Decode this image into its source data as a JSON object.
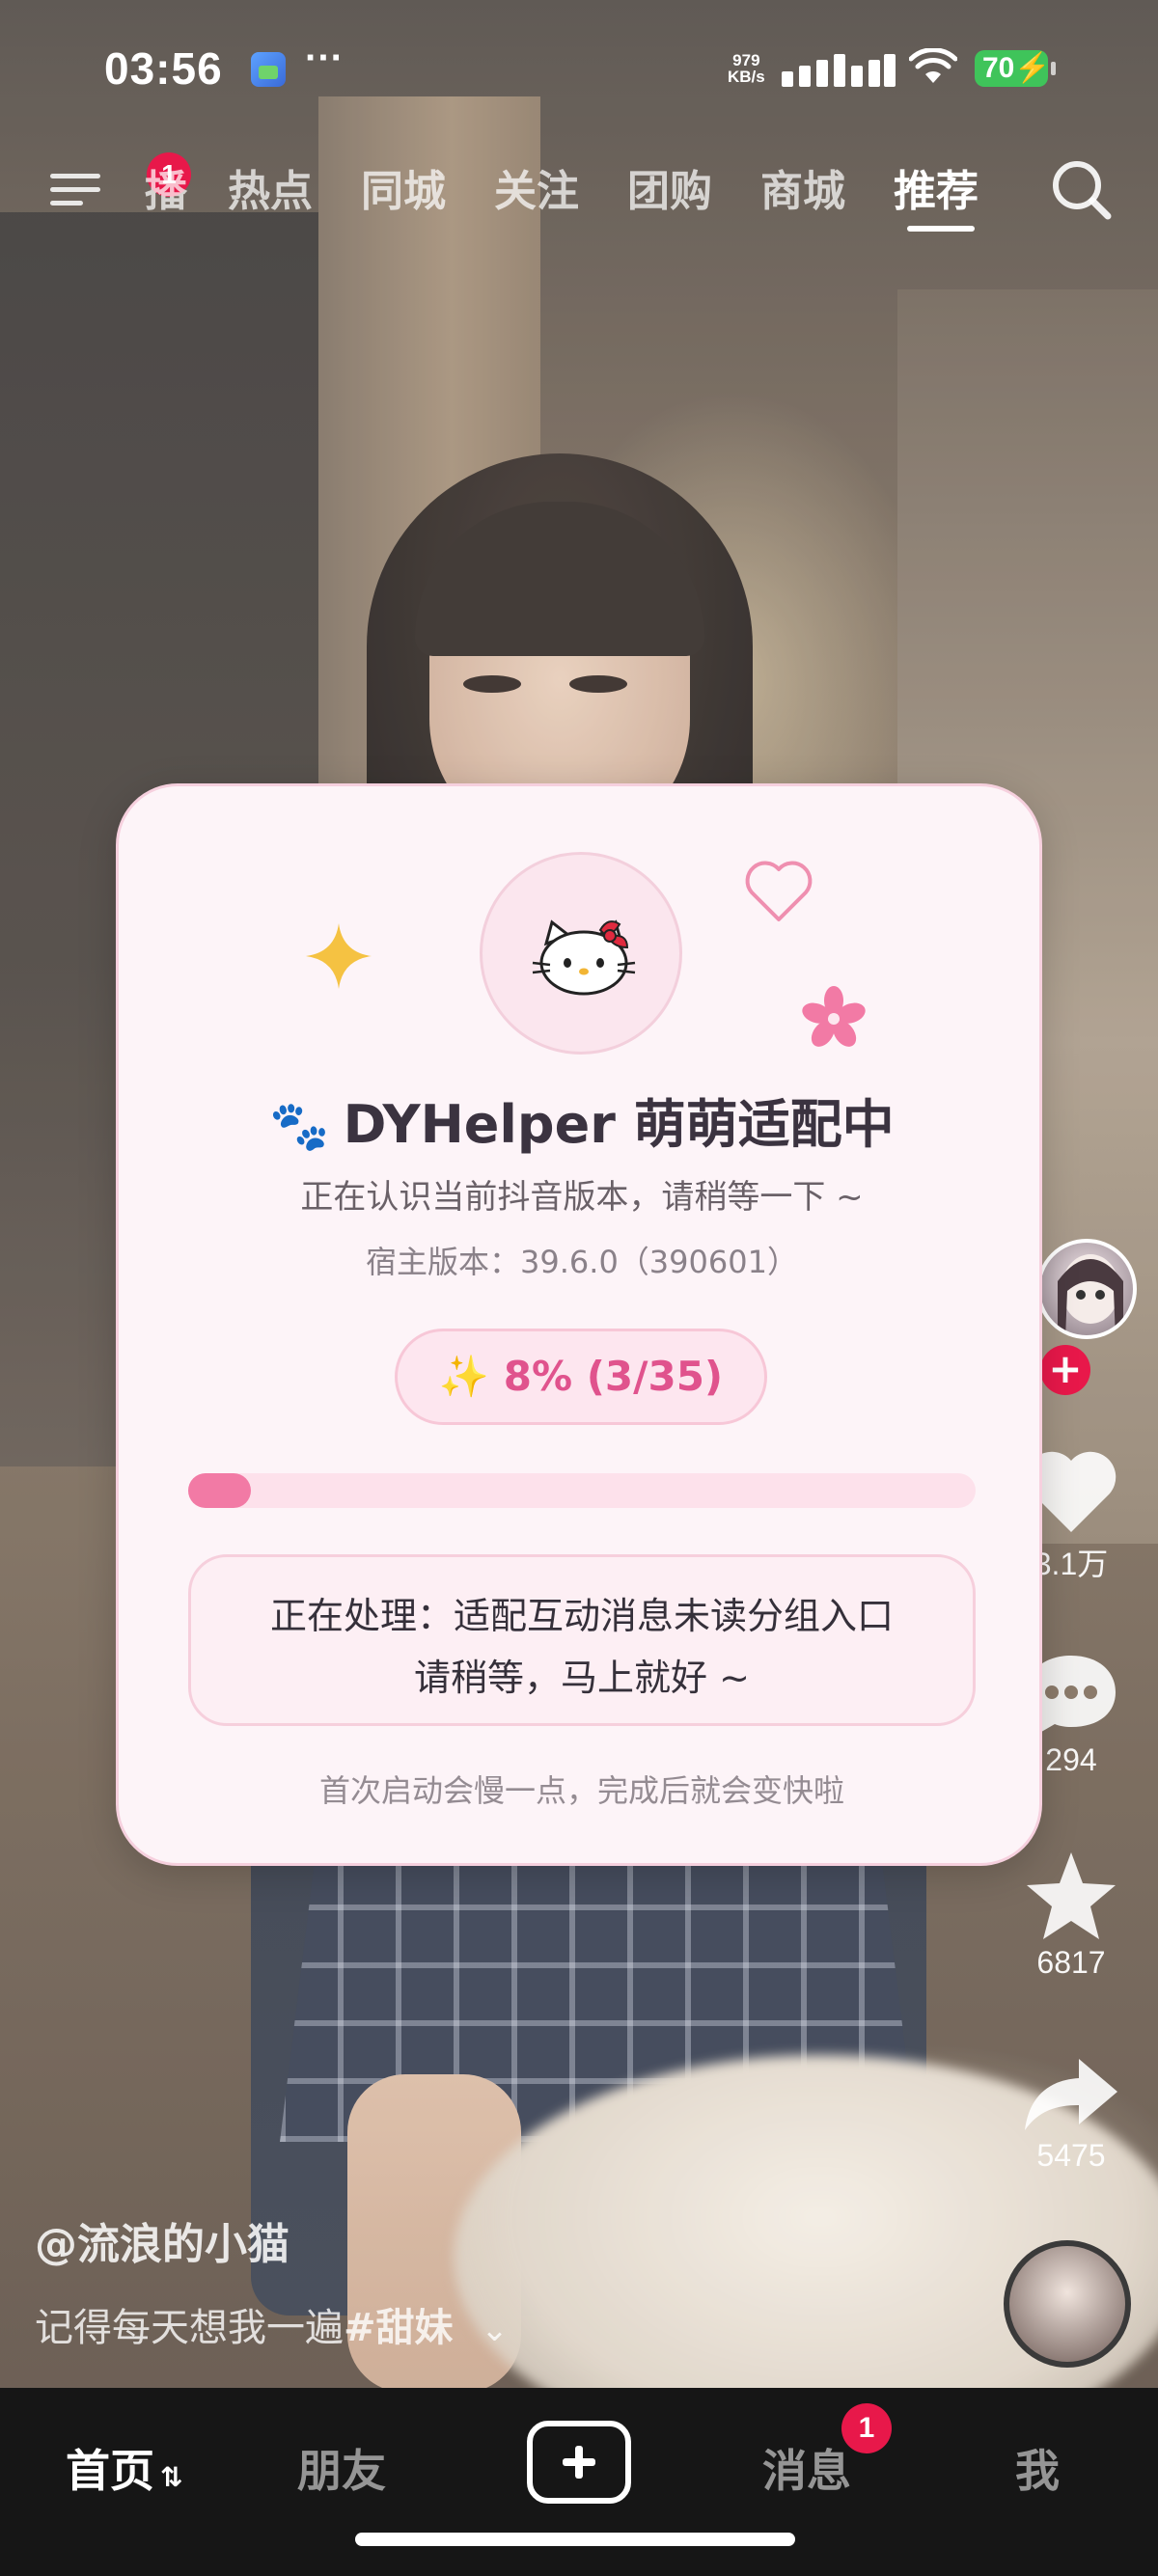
{
  "status_bar": {
    "time": "03:56",
    "more_dots": "···",
    "net_speed_value": "979",
    "net_speed_unit": "KB/s",
    "battery": "70",
    "battery_color": "#3fc45a"
  },
  "top_nav": {
    "menu_badge": "1",
    "tabs": [
      "播",
      "热点",
      "同城",
      "关注",
      "团购",
      "商城",
      "推荐"
    ],
    "active_tab": "推荐"
  },
  "right_rail": {
    "like_count": "3.1万",
    "comment_count": "294",
    "favorite_count": "6817",
    "share_count": "5475",
    "follow_symbol": "+"
  },
  "caption": {
    "author": "@流浪的小猫",
    "text": "记得每天想我一遍",
    "hashtag": "#甜妹",
    "expand_symbol": "⌄"
  },
  "bottom_nav": {
    "home": "首页",
    "home_swap": "⇅",
    "friends": "朋友",
    "messages": "消息",
    "messages_badge": "1",
    "me": "我"
  },
  "dialog": {
    "title_icon": "🐾",
    "title": "DYHelper 萌萌适配中",
    "subtitle": "正在认识当前抖音版本，请稍等一下 ~",
    "host_version": "宿主版本：39.6.0（390601）",
    "progress_label": "✨ 8% (3/35)",
    "progress_value": 8,
    "processing_line1": "正在处理：适配互动消息未读分组入口",
    "processing_line2": "请稍等，马上就好 ~",
    "footer": "首次启动会慢一点，完成后就会变快啦",
    "accent_color": "#f27aa5",
    "background_color": "#fdf4f8"
  }
}
